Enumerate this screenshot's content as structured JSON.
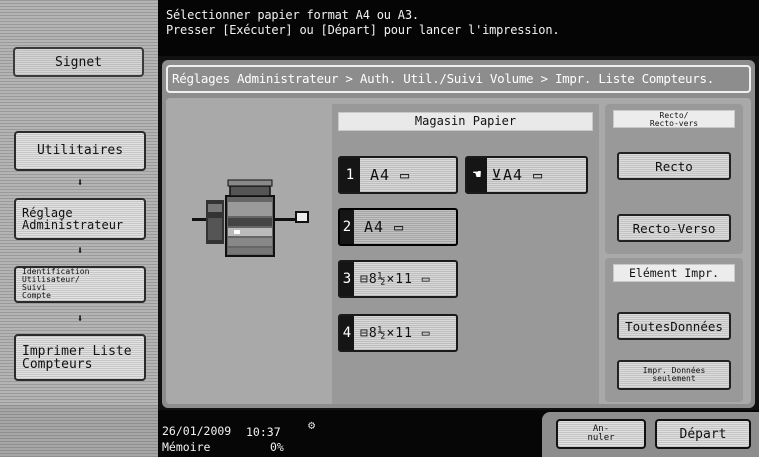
{
  "message": {
    "line1": "Sélectionner papier format A4 ou A3.",
    "line2": "Presser [Exécuter] ou [Départ] pour lancer l'impression."
  },
  "left_nav": {
    "signet": "Signet",
    "utilitaires": "Utilitaires",
    "reglage_admin": "Réglage\nAdministrateur",
    "identification": "Identification\nUtilisateur/\nSuivi\nCompte",
    "imprimer_liste": "Imprimer Liste\nCompteurs"
  },
  "breadcrumb": "Réglages Administrateur > Auth. Util./Suivi Volume > Impr. Liste Compteurs.",
  "magasin": {
    "title": "Magasin Papier",
    "trays": [
      {
        "num": "1",
        "label": "A4 ▭"
      },
      {
        "num": "☚",
        "label": "⊻A4 ▭"
      },
      {
        "num": "2",
        "label": "A4 ▭"
      },
      {
        "num": "3",
        "label": "⊟8½×11 ▭"
      },
      {
        "num": "4",
        "label": "⊟8½×11 ▭"
      }
    ]
  },
  "recto_verso": {
    "header": "Recto/\nRecto-vers",
    "recto": "Recto",
    "recto_verso": "Recto-Verso"
  },
  "element_impr": {
    "header": "Elément Impr.",
    "toutes": "ToutesDonnées",
    "impr_donnees": "Impr. Données\nseulement"
  },
  "status": {
    "date": "26/01/2009",
    "time": "10:37",
    "memory_label": "Mémoire",
    "memory_value": "0%",
    "annuler": "An-\nnuler",
    "depart": "Départ"
  },
  "colors": {
    "bar": "#050505",
    "panel": "#8d8d8d",
    "content": "#a9a9a9"
  }
}
